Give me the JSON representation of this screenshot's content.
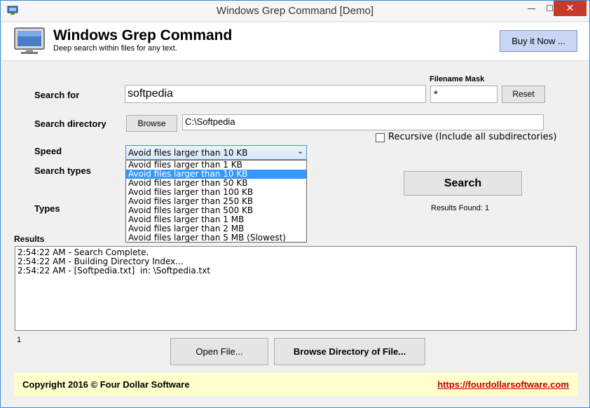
{
  "window": {
    "title": "Windows Grep Command [Demo]",
    "minimize": "—",
    "maximize": "☐",
    "close": "✕"
  },
  "header": {
    "app_title": "Windows Grep Command",
    "subtitle": "Deep search within files for any text.",
    "buy_label": "Buy it Now ..."
  },
  "search": {
    "label": "Search for",
    "value": "softpedia",
    "filename_mask_label": "Filename Mask",
    "filename_mask_value": "*",
    "reset_label": "Reset"
  },
  "directory": {
    "label": "Search directory",
    "browse_label": "Browse",
    "value": "C:\\Softpedia",
    "recursive_label": "Recursive (Include all subdirectories)",
    "recursive_checked": false
  },
  "speed": {
    "label": "Speed",
    "selected": "Avoid files larger than 10 KB",
    "options": [
      "Avoid files larger than 1 KB",
      "Avoid files larger than 10 KB",
      "Avoid files larger than 50 KB",
      "Avoid files larger than 100 KB",
      "Avoid files larger than 250 KB",
      "Avoid files larger than 500 KB",
      "Avoid files larger than 1 MB",
      "Avoid files larger than 2 MB",
      "Avoid files larger than 5 MB (Slowest)"
    ],
    "highlighted_index": 1
  },
  "search_types": {
    "label": "Search types"
  },
  "types": {
    "label": "Types"
  },
  "actions": {
    "search_label": "Search",
    "results_found": "Results Found: 1"
  },
  "results": {
    "label": "Results",
    "lines": [
      "2:54:22 AM - Search Complete.",
      "2:54:22 AM - Building Directory Index...",
      "2:54:22 AM - [Softpedia.txt]  in: \\Softpedia.txt"
    ],
    "count": "1"
  },
  "bottom_buttons": {
    "open_file": "Open File...",
    "browse_dir": "Browse Directory of File..."
  },
  "footer": {
    "copyright": "Copyright 2016 © Four Dollar Software",
    "link": "https://fourdollarsoftware.com"
  },
  "colors": {
    "accent": "#3399ff",
    "footer_bg": "#ffffcc",
    "link": "#c00000",
    "buy_bg": "#c8d5f5"
  }
}
